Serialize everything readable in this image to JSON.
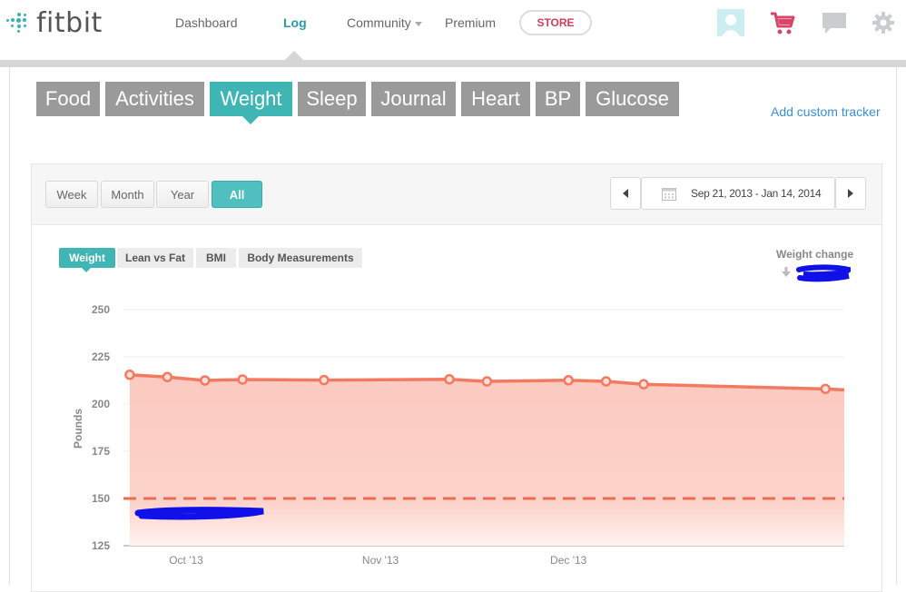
{
  "brand": {
    "name": "fitbit"
  },
  "nav": {
    "links": [
      "Dashboard",
      "Log",
      "Community",
      "Premium"
    ],
    "store_label": "STORE"
  },
  "trackers": {
    "tabs": [
      "Food",
      "Activities",
      "Weight",
      "Sleep",
      "Journal",
      "Heart",
      "BP",
      "Glucose"
    ],
    "active": "Weight",
    "add_custom": "Add custom tracker"
  },
  "period": {
    "buttons": [
      "Week",
      "Month",
      "Year",
      "All"
    ],
    "active": "All",
    "date_range": "Sep 21, 2013 - Jan 14, 2014"
  },
  "subtabs": {
    "items": [
      "Weight",
      "Lean vs Fat",
      "BMI",
      "Body Measurements"
    ],
    "active": "Weight"
  },
  "weight_change": {
    "label": "Weight change"
  },
  "colors": {
    "accent": "#3fb6b4",
    "tab_gray": "#9a9a9a",
    "line": "#f17a61",
    "fill": "#fbc9bf",
    "store_text": "#d23b5a",
    "link": "#3a8fd1"
  },
  "chart_data": {
    "type": "area",
    "ylabel": "Pounds",
    "ylim": [
      125,
      250
    ],
    "yticks": [
      125,
      150,
      175,
      200,
      225,
      250
    ],
    "x_tick_labels": [
      "Oct '13",
      "Nov '13",
      "Dec '13"
    ],
    "x_range": [
      "2013-09-21",
      "2014-01-14"
    ],
    "series": [
      {
        "x": [
          "2013-09-22",
          "2013-09-28",
          "2013-10-04",
          "2013-10-10",
          "2013-10-23",
          "2013-11-12",
          "2013-11-18",
          "2013-12-01",
          "2013-12-07",
          "2013-12-13",
          "2014-01-11"
        ],
        "values": [
          215.5,
          214.3,
          212.5,
          213.0,
          212.7,
          213.1,
          212.0,
          212.6,
          212.0,
          210.5,
          208.0
        ]
      }
    ],
    "goal_line": 150,
    "grid": true
  }
}
